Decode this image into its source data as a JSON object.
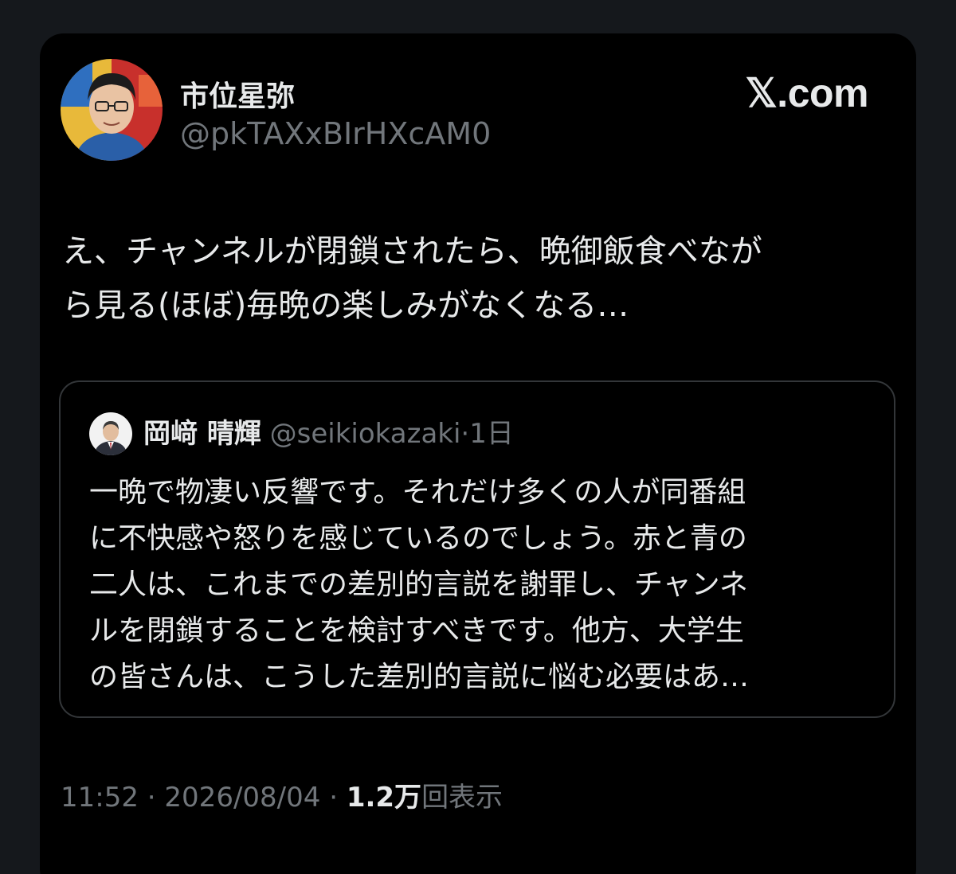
{
  "author": {
    "display_name": "市位星弥",
    "handle": "@pkTAXxBIrHXcAM0",
    "avatar_icon": "profile-photo-icon"
  },
  "brand": "𝕏.com",
  "tweet": {
    "lines": [
      "え、チャンネルが閉鎖されたら、晩御飯食べなが",
      "ら見る(ほぼ)毎晩の楽しみがなくなる…"
    ]
  },
  "quote": {
    "display_name": "岡﨑 晴輝",
    "handle": "@seikiokazaki",
    "separator": "·",
    "time": "1日",
    "avatar_icon": "profile-photo-icon",
    "lines": [
      "一晩で物凄い反響です。それだけ多くの人が同番組",
      "に不快感や怒りを感じているのでしょう。赤と青の",
      "二人は、これまでの差別的言説を謝罪し、チャンネ",
      "ルを閉鎖することを検討すべきです。他方、大学生",
      "の皆さんは、こうした差別的言説に悩む必要はあ…"
    ]
  },
  "meta": {
    "time": "11:52",
    "date": "2026/08/04",
    "separator": " · ",
    "views_count": "1.2万",
    "views_label": "回表示"
  }
}
